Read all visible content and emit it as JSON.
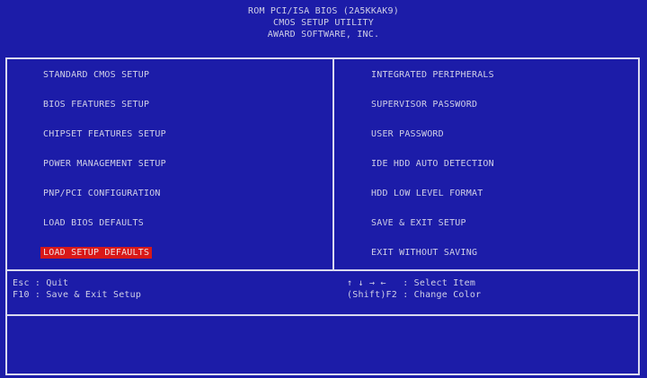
{
  "header": {
    "line1": "ROM PCI/ISA BIOS (2A5KKAK9)",
    "line2": "CMOS SETUP UTILITY",
    "line3": "AWARD SOFTWARE, INC."
  },
  "menu": {
    "left": [
      "STANDARD CMOS SETUP",
      "BIOS FEATURES SETUP",
      "CHIPSET FEATURES SETUP",
      "POWER MANAGEMENT SETUP",
      "PNP/PCI CONFIGURATION",
      "LOAD BIOS DEFAULTS",
      "LOAD SETUP DEFAULTS"
    ],
    "right": [
      "INTEGRATED PERIPHERALS",
      "SUPERVISOR PASSWORD",
      "USER PASSWORD",
      "IDE HDD AUTO DETECTION",
      "HDD LOW LEVEL FORMAT",
      "SAVE & EXIT SETUP",
      "EXIT WITHOUT SAVING"
    ],
    "selected": "LOAD SETUP DEFAULTS"
  },
  "help": {
    "esc": "Esc : Quit",
    "f10": "F10 : Save & Exit Setup",
    "select": "↑ ↓ → ←   : Select Item",
    "color": "(Shift)F2 : Change Color"
  },
  "status": {
    "message": ""
  },
  "colors": {
    "background": "#1c1ca8",
    "text": "#cfcfe6",
    "highlight": "#d81818",
    "border": "#d9d9ef"
  }
}
